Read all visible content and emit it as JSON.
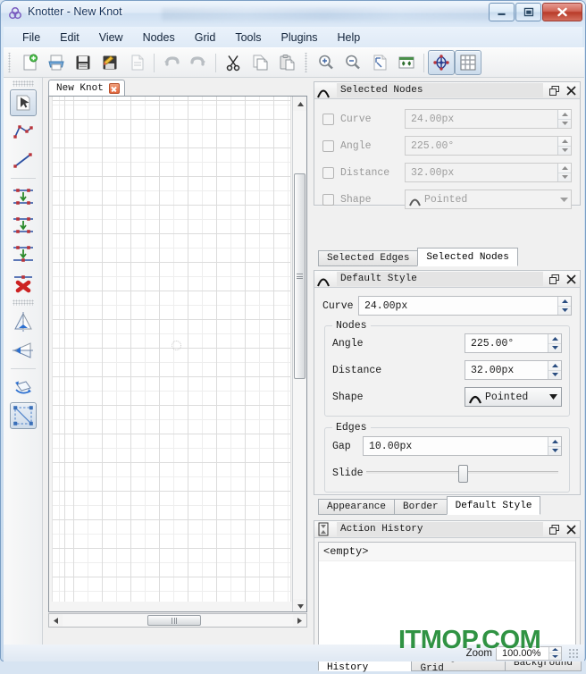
{
  "window": {
    "title": "Knotter - New Knot",
    "app_icon": "knot-triquetra-icon",
    "minimize_label": "",
    "maximize_label": "",
    "close_label": ""
  },
  "menubar": {
    "items": [
      {
        "label": "File"
      },
      {
        "label": "Edit"
      },
      {
        "label": "View"
      },
      {
        "label": "Nodes"
      },
      {
        "label": "Grid"
      },
      {
        "label": "Tools"
      },
      {
        "label": "Plugins"
      },
      {
        "label": "Help"
      }
    ]
  },
  "toolbar": {
    "groups": [
      {
        "buttons": [
          {
            "icon": "new-file-icon",
            "active": false
          },
          {
            "icon": "open-file-icon",
            "active": false
          },
          {
            "icon": "save-icon",
            "active": false
          },
          {
            "icon": "save-as-icon",
            "active": false
          },
          {
            "icon": "export-icon",
            "active": false
          },
          {
            "icon": "undo-icon",
            "active": false
          },
          {
            "icon": "redo-icon",
            "active": false
          },
          {
            "icon": "cut-icon",
            "active": false
          },
          {
            "icon": "copy-icon",
            "active": false
          },
          {
            "icon": "paste-icon",
            "active": false
          }
        ]
      },
      {
        "buttons": [
          {
            "icon": "zoom-in-icon",
            "active": false
          },
          {
            "icon": "zoom-out-icon",
            "active": false
          },
          {
            "icon": "zoom-fit-page-icon",
            "active": false
          },
          {
            "icon": "zoom-fit-width-icon",
            "active": false
          },
          {
            "icon": "toggle-knot-icon",
            "active": true
          },
          {
            "icon": "toggle-grid-icon",
            "active": true
          }
        ]
      }
    ]
  },
  "left_toolbar": {
    "buttons": [
      {
        "icon": "select-arrow-tool-icon",
        "active": true
      },
      {
        "icon": "draw-polyline-tool-icon",
        "active": false
      },
      {
        "icon": "draw-line-tool-icon",
        "active": false
      },
      {
        "icon": "link-nodes-icon",
        "active": false
      },
      {
        "icon": "merge-nodes-icon",
        "active": false
      },
      {
        "icon": "break-edge-icon",
        "active": false
      },
      {
        "icon": "delete-node-icon",
        "active": false
      },
      {
        "icon": "flip-vertical-icon",
        "active": false
      },
      {
        "icon": "flip-horizontal-icon",
        "active": false
      },
      {
        "icon": "rotate-icon",
        "active": false
      },
      {
        "icon": "transform-selection-icon",
        "active": true
      }
    ]
  },
  "canvas": {
    "tab": {
      "label": "New Knot",
      "close_icon": "close-tab-icon"
    },
    "grid_visible": true,
    "origin_marker": "origin-node-circle",
    "vscroll": {
      "up_icon": "scroll-up-arrow-icon",
      "down_icon": "scroll-down-arrow-icon"
    },
    "hscroll": {
      "left_icon": "scroll-left-arrow-icon",
      "right_icon": "scroll-right-arrow-icon"
    }
  },
  "selected_nodes_panel": {
    "title": "Selected Nodes",
    "title_icon": "pointed-shape-icon",
    "float_icon": "undock-panel-icon",
    "close_icon": "close-panel-icon",
    "fields": [
      {
        "label": "Curve",
        "value": "24.00px",
        "checked": false,
        "enabled": false,
        "control": "spinbox"
      },
      {
        "label": "Angle",
        "value": "225.00°",
        "checked": false,
        "enabled": false,
        "control": "spinbox"
      },
      {
        "label": "Distance",
        "value": "32.00px",
        "checked": false,
        "enabled": false,
        "control": "spinbox"
      },
      {
        "label": "Shape",
        "value": "Pointed",
        "checked": false,
        "enabled": false,
        "control": "combobox"
      }
    ],
    "tabs": [
      {
        "label": "Selected Edges",
        "active": false
      },
      {
        "label": "Selected Nodes",
        "active": true
      }
    ]
  },
  "default_style_panel": {
    "title": "Default Style",
    "title_icon": "pointed-shape-icon",
    "float_icon": "undock-panel-icon",
    "close_icon": "close-panel-icon",
    "curve": {
      "label": "Curve",
      "value": "24.00px"
    },
    "nodes_group": {
      "legend": "Nodes",
      "fields": [
        {
          "label": "Angle",
          "value": "225.00°",
          "control": "spinbox"
        },
        {
          "label": "Distance",
          "value": "32.00px",
          "control": "spinbox"
        },
        {
          "label": "Shape",
          "value": "Pointed",
          "control": "combobox"
        }
      ]
    },
    "edges_group": {
      "legend": "Edges",
      "gap": {
        "label": "Gap",
        "value": "10.00px"
      },
      "slide": {
        "label": "Slide",
        "position_percent": 48
      }
    },
    "tabs": [
      {
        "label": "Appearance",
        "active": false
      },
      {
        "label": "Border",
        "active": false
      },
      {
        "label": "Default Style",
        "active": true
      }
    ]
  },
  "action_history_panel": {
    "title": "Action History",
    "title_icon": "hourglass-icon",
    "float_icon": "undock-panel-icon",
    "close_icon": "close-panel-icon",
    "items": [
      "<empty>"
    ],
    "tabs": [
      {
        "label": "Action History",
        "active": true
      },
      {
        "label": "Configure Grid",
        "active": false
      },
      {
        "label": "Background",
        "active": false
      }
    ]
  },
  "statusbar": {
    "zoom_label": "Zoom",
    "zoom_value": "100.00%",
    "size_grip": "resize-grip-icon"
  },
  "watermark": {
    "text": "ITMOP.COM",
    "color": "#1f8a34"
  }
}
